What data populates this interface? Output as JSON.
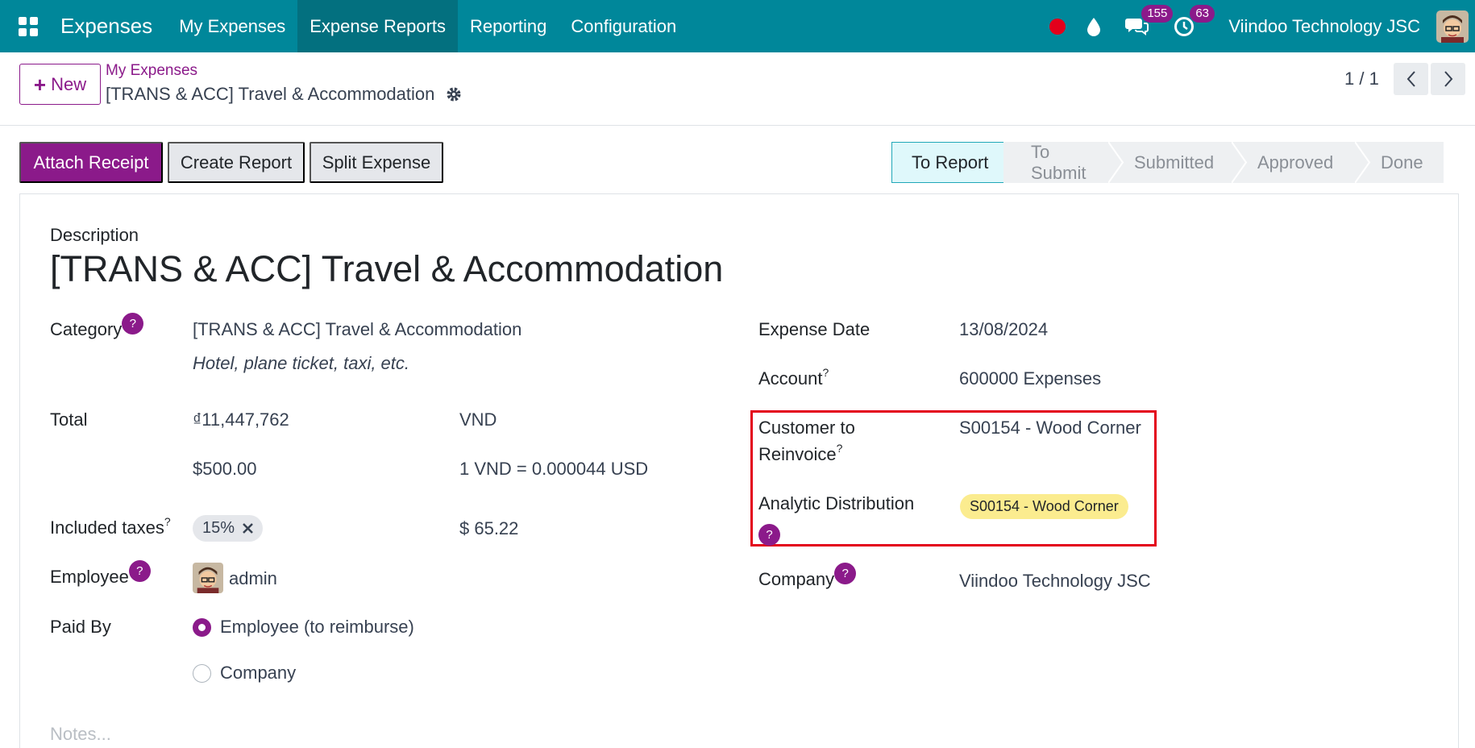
{
  "navbar": {
    "app_name": "Expenses",
    "menu": [
      "My Expenses",
      "Expense Reports",
      "Reporting",
      "Configuration"
    ],
    "messages_count": "155",
    "activities_count": "63",
    "company": "Viindoo Technology JSC"
  },
  "control_panel": {
    "new_label": "New",
    "breadcrumb_parent": "My Expenses",
    "breadcrumb_current": "[TRANS & ACC] Travel & Accommodation",
    "pager": "1 / 1"
  },
  "actions": {
    "attach_receipt": "Attach Receipt",
    "create_report": "Create Report",
    "split_expense": "Split Expense"
  },
  "statusbar": {
    "stages": [
      "To Report",
      "To Submit",
      "Submitted",
      "Approved",
      "Done"
    ],
    "current": "To Report"
  },
  "form": {
    "description_label": "Description",
    "description": "[TRANS & ACC] Travel & Accommodation",
    "category_label": "Category",
    "category": "[TRANS & ACC] Travel & Accommodation",
    "category_note": "Hotel, plane ticket, taxi, etc.",
    "total_label": "Total",
    "total": "₫11,447,762",
    "currency": "VND",
    "total_usd": "$500.00",
    "rate": "1 VND = 0.000044 USD",
    "taxes_label": "Included taxes",
    "tax_tag": "15%",
    "tax_amount": "$ 65.22",
    "employee_label": "Employee",
    "employee": "admin",
    "paid_by_label": "Paid By",
    "paid_by_options": [
      "Employee (to reimburse)",
      "Company"
    ],
    "paid_by_selected": "Employee (to reimburse)",
    "expense_date_label": "Expense Date",
    "expense_date": "13/08/2024",
    "account_label": "Account",
    "account": "600000 Expenses",
    "reinvoice_label_1": "Customer to",
    "reinvoice_label_2": "Reinvoice",
    "reinvoice": "S00154 - Wood Corner",
    "analytic_label": "Analytic Distribution",
    "analytic_tag": "S00154 - Wood Corner",
    "company_label": "Company",
    "company": "Viindoo Technology JSC",
    "notes_placeholder": "Notes..."
  },
  "colors": {
    "navbar": "#00879a",
    "primary": "#8b1a8a",
    "highlight_box": "#e3001b",
    "analytic_tag": "#fbec8f",
    "current_stage": "#dff8fb"
  },
  "icons": [
    "apps-grid-icon",
    "record-dot-icon",
    "drop-icon",
    "chat-icon",
    "clock-icon",
    "gear-icon",
    "chevron-left-icon",
    "chevron-right-icon",
    "close-icon"
  ]
}
